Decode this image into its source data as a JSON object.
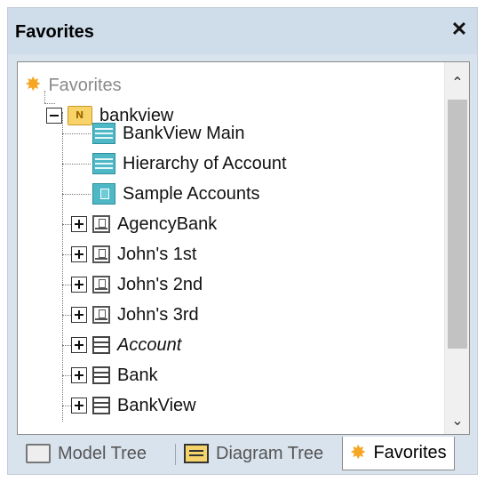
{
  "panel": {
    "title": "Favorites",
    "close_glyph": "✕"
  },
  "tree": {
    "root": {
      "label": "Favorites",
      "icon": "favorites-star-icon"
    },
    "folder": {
      "label": "bankview",
      "icon": "namespace-folder-icon",
      "expander": "collapse"
    },
    "items": [
      {
        "label": "BankView Main",
        "icon": "diagram-icon"
      },
      {
        "label": "Hierarchy of Account",
        "icon": "diagram-icon"
      },
      {
        "label": "Sample Accounts",
        "icon": "instance-diagram-icon"
      },
      {
        "label": "AgencyBank",
        "icon": "object-icon",
        "expander": "expand"
      },
      {
        "label": "John's 1st",
        "icon": "object-icon",
        "expander": "expand"
      },
      {
        "label": "John's 2nd",
        "icon": "object-icon",
        "expander": "expand"
      },
      {
        "label": "John's 3rd",
        "icon": "object-icon",
        "expander": "expand"
      },
      {
        "label": "Account",
        "icon": "class-icon",
        "expander": "expand",
        "italic": true
      },
      {
        "label": "Bank",
        "icon": "class-icon",
        "expander": "expand"
      },
      {
        "label": "BankView",
        "icon": "class-icon",
        "expander": "expand"
      }
    ]
  },
  "scrollbar": {
    "up_glyph": "⌃",
    "down_glyph": "⌄"
  },
  "tabs": [
    {
      "label": "Model Tree",
      "icon": "model-tree-folder-icon",
      "active": false
    },
    {
      "label": "Diagram Tree",
      "icon": "diagram-tree-icon",
      "active": false
    },
    {
      "label": "Favorites",
      "icon": "favorites-star-icon",
      "active": true
    }
  ],
  "colors": {
    "panel_bg": "#d9e3ee",
    "titlebar_bg": "#cfdcea",
    "diagram_teal": "#4fb8c6",
    "folder_yellow": "#f7d36a",
    "star_orange": "#f5a623"
  }
}
